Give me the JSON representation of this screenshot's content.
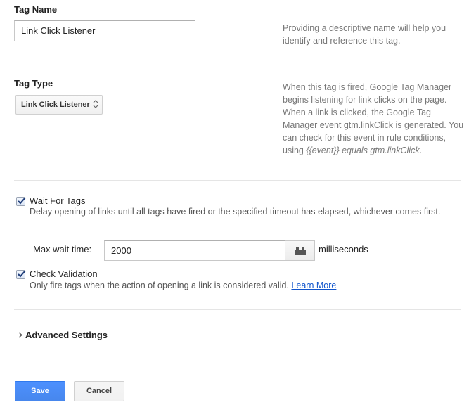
{
  "tag_name": {
    "label": "Tag Name",
    "value": "Link Click Listener",
    "help": "Providing a descriptive name will help you identify and reference this tag."
  },
  "tag_type": {
    "label": "Tag Type",
    "selected": "Link Click Listener",
    "help_prefix": "When this tag is fired, Google Tag Manager begins listening for link clicks on the page. When a link is clicked, the Google Tag Manager event gtm.linkClick is generated. You can check for this event in rule conditions, using ",
    "help_em": "{{event}} equals gtm.linkClick",
    "help_suffix": "."
  },
  "wait_for_tags": {
    "label": "Wait For Tags",
    "checked": true,
    "description": "Delay opening of links until all tags have fired or the specified timeout has elapsed, whichever comes first.",
    "max_wait_label": "Max wait time:",
    "max_wait_value": "2000",
    "units": "milliseconds",
    "widget_icon": "lego-brick-icon"
  },
  "check_validation": {
    "label": "Check Validation",
    "checked": true,
    "description": "Only fire tags when the action of opening a link is considered valid.",
    "learn_more": "Learn More"
  },
  "advanced": {
    "label": "Advanced Settings",
    "icon": "chevron-right-icon"
  },
  "buttons": {
    "save": "Save",
    "cancel": "Cancel"
  },
  "colors": {
    "primary": "#4d90fe",
    "link": "#1155cc",
    "help_text": "#777777"
  }
}
